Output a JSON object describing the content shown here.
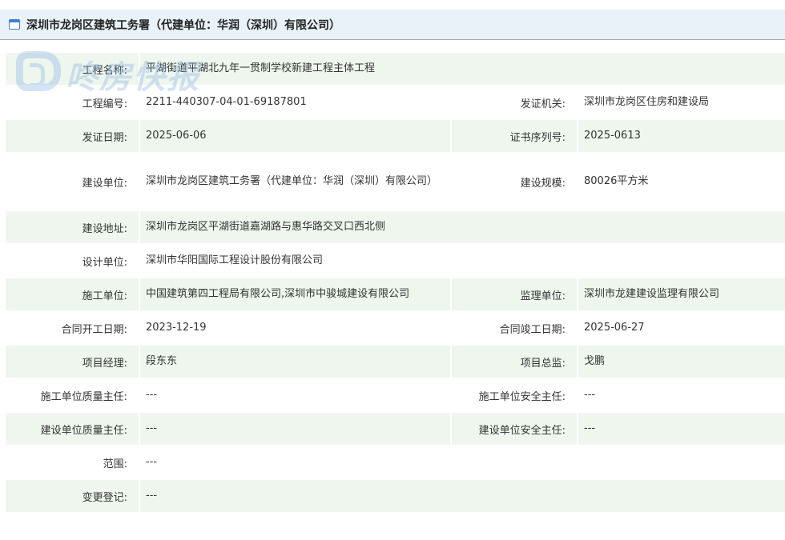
{
  "header": {
    "title": "深圳市龙岗区建筑工务署（代建单位：华润（深圳）有限公司）",
    "icon": "window-icon"
  },
  "watermark": {
    "text": "咚房快报"
  },
  "rows": [
    {
      "label1": "工程名称:",
      "value1": "平湖街道平湖北九年一贯制学校新建工程主体工程"
    },
    {
      "label1": "工程编号:",
      "value1": "2211-440307-04-01-69187801",
      "label2": "发证机关:",
      "value2": "深圳市龙岗区住房和建设局"
    },
    {
      "label1": "发证日期:",
      "value1": "2025-06-06",
      "label2": "证书序列号:",
      "value2": "2025-0613"
    },
    {
      "label1": "建设单位:",
      "value1": "深圳市龙岗区建筑工务署（代建单位：华润（深圳）有限公司）",
      "label2": "建设规模:",
      "value2": "80026平方米"
    },
    {
      "label1": "建设地址:",
      "value1": "深圳市龙岗区平湖街道嘉湖路与惠华路交叉口西北侧"
    },
    {
      "label1": "设计单位:",
      "value1": "深圳市华阳国际工程设计股份有限公司"
    },
    {
      "label1": "施工单位:",
      "value1": "中国建筑第四工程局有限公司,深圳市中骏城建设有限公司",
      "label2": "监理单位:",
      "value2": "深圳市龙建建设监理有限公司"
    },
    {
      "label1": "合同开工日期:",
      "value1": "2023-12-19",
      "label2": "合同竣工日期:",
      "value2": "2025-06-27"
    },
    {
      "label1": "项目经理:",
      "value1": "段东东",
      "label2": "项目总监:",
      "value2": "戈鹏"
    },
    {
      "label1": "施工单位质量主任:",
      "value1": "---",
      "label2": "施工单位安全主任:",
      "value2": "---"
    },
    {
      "label1": "建设单位质量主任:",
      "value1": "---",
      "label2": "建设单位安全主任:",
      "value2": "---"
    },
    {
      "label1": "范围:",
      "value1": "---"
    },
    {
      "label1": "变更登记:",
      "value1": "---"
    }
  ],
  "colors": {
    "header_bg": "#e9f2f9",
    "row_shade": "#eef6ee",
    "icon_accent": "#3a7fd5"
  }
}
